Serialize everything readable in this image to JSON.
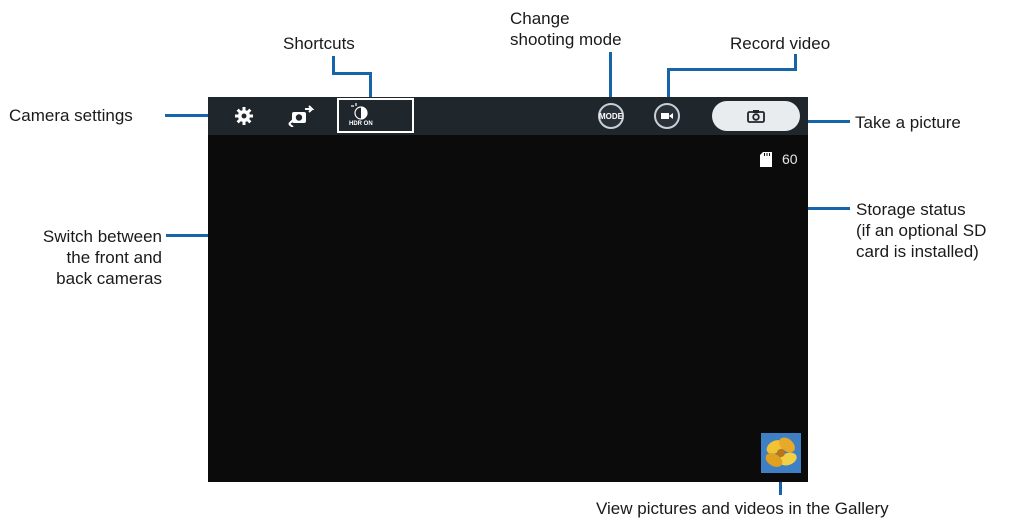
{
  "callouts": {
    "shortcuts": "Shortcuts",
    "change_mode_line1": "Change",
    "change_mode_line2": "shooting mode",
    "record_video": "Record video",
    "camera_settings": "Camera settings",
    "take_picture": "Take a picture",
    "switch_line1": "Switch between",
    "switch_line2": "the front and",
    "switch_line3": "back cameras",
    "storage_line1": "Storage status",
    "storage_line2": "(if an optional SD",
    "storage_line3": "card is installed)",
    "gallery": "View pictures and videos in the Gallery"
  },
  "camera_ui": {
    "hdr_label": "HDR ON",
    "mode_label": "MODE",
    "storage_count": "60"
  },
  "icons": {
    "settings": "gear-icon",
    "switch_camera": "switch-camera-icon",
    "hdr": "hdr-icon",
    "mode": "mode-icon",
    "video": "video-camera-icon",
    "shutter": "camera-icon",
    "sd_card": "sd-card-icon",
    "gallery": "gallery-thumbnail"
  },
  "colors": {
    "callout_line": "#1565a8",
    "screen_bg": "#0b0b0b",
    "topbar_bg": "#1f262c"
  }
}
